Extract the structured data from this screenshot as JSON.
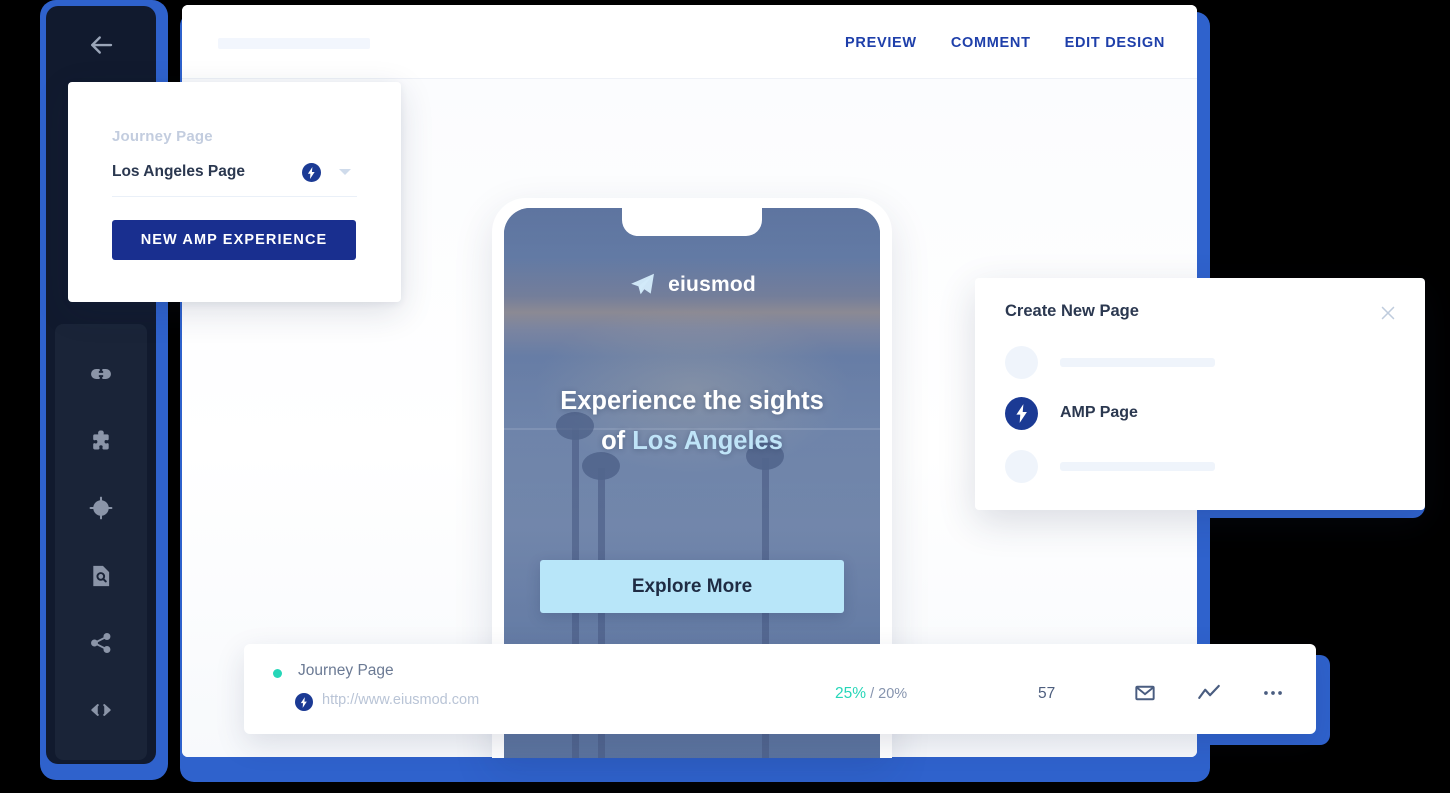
{
  "topbar": {
    "nav": [
      {
        "label": "PREVIEW",
        "name": "nav-preview"
      },
      {
        "label": "COMMENT",
        "name": "nav-comment"
      },
      {
        "label": "EDIT DESIGN",
        "name": "nav-edit-design"
      }
    ]
  },
  "sidebar": {
    "back_icon": "back-arrow-icon",
    "tools": [
      {
        "icon": "link-icon"
      },
      {
        "icon": "puzzle-piece-icon"
      },
      {
        "icon": "target-icon"
      },
      {
        "icon": "document-search-icon"
      },
      {
        "icon": "share-icon"
      },
      {
        "icon": "code-brackets-icon"
      }
    ]
  },
  "journey_card": {
    "label": "Journey Page",
    "selected_page": "Los Angeles Page",
    "badge_icon": "amp-bolt-icon",
    "dropdown_icon": "chevron-down-icon",
    "button_label": "NEW AMP EXPERIENCE"
  },
  "phone": {
    "brand_icon": "paper-plane-icon",
    "brand_name": "eiusmod",
    "headline_line1": "Experience the sights",
    "headline_prefix": "of ",
    "headline_highlight": "Los Angeles",
    "cta_label": "Explore More"
  },
  "modal": {
    "title": "Create New Page",
    "close_icon": "close-icon",
    "amp_icon": "amp-bolt-icon",
    "amp_label": "AMP Page"
  },
  "status_bar": {
    "page_title": "Journey Page",
    "amp_icon": "amp-bolt-icon",
    "url": "http://www.eiusmod.com",
    "rate_current": "25%",
    "rate_separator": "/",
    "rate_target": "20%",
    "count": "57",
    "actions": [
      {
        "icon": "envelope-icon"
      },
      {
        "icon": "trend-line-icon"
      },
      {
        "icon": "more-horizontal-icon"
      }
    ]
  },
  "colors": {
    "brand_blue": "#192f8f",
    "accent_blue": "#1e3faa",
    "backing_blue": "#2f62cc",
    "rail_dark": "#111a2e",
    "teal": "#26d6b8",
    "cta_cyan": "#b8e6f9"
  }
}
